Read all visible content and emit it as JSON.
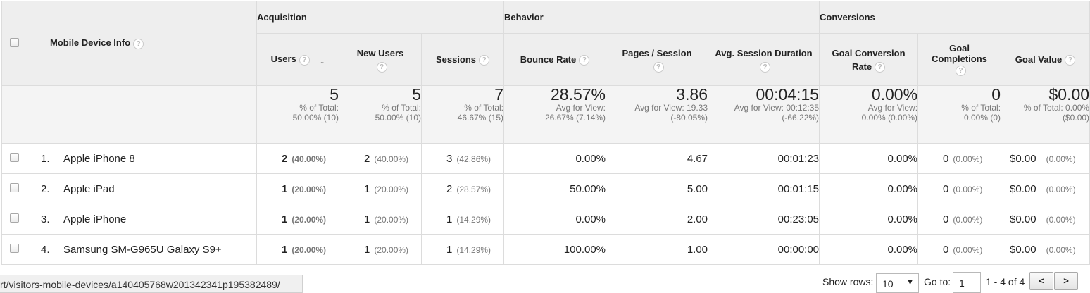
{
  "header": {
    "groups": {
      "acquisition": "Acquisition",
      "behavior": "Behavior",
      "conversions": "Conversions"
    },
    "device_col": "Mobile Device Info",
    "columns": {
      "users": "Users",
      "new_users": "New Users",
      "sessions": "Sessions",
      "bounce_rate": "Bounce Rate",
      "pages_session": "Pages / Session",
      "avg_duration": "Avg. Session Duration",
      "goal_conv_rate_1": "Goal Conversion",
      "goal_conv_rate_2": "Rate",
      "goal_completions_1": "Goal",
      "goal_completions_2": "Completions",
      "goal_value": "Goal Value"
    },
    "help_glyph": "?",
    "sort_glyph": "↓"
  },
  "totals": {
    "users": {
      "big": "5",
      "s1": "% of Total:",
      "s2": "50.00% (10)"
    },
    "new_users": {
      "big": "5",
      "s1": "% of Total:",
      "s2": "50.00% (10)"
    },
    "sessions": {
      "big": "7",
      "s1": "% of Total:",
      "s2": "46.67% (15)"
    },
    "bounce_rate": {
      "big": "28.57%",
      "s1": "Avg for View:",
      "s2": "26.67% (7.14%)"
    },
    "pages_session": {
      "big": "3.86",
      "s1": "Avg for View: 19.33",
      "s2": "(-80.05%)"
    },
    "avg_duration": {
      "big": "00:04:15",
      "s1": "Avg for View: 00:12:35",
      "s2": "(-66.22%)"
    },
    "goal_conv_rate": {
      "big": "0.00%",
      "s1": "Avg for View:",
      "s2": "0.00% (0.00%)"
    },
    "goal_completions": {
      "big": "0",
      "s1": "% of Total:",
      "s2": "0.00% (0)"
    },
    "goal_value": {
      "big": "$0.00",
      "s1": "% of Total: 0.00%",
      "s2": "($0.00)"
    }
  },
  "rows": [
    {
      "num": "1.",
      "device": "Apple iPhone 8",
      "users": "2",
      "users_pct": "(40.00%)",
      "new_users": "2",
      "new_users_pct": "(40.00%)",
      "sessions": "3",
      "sessions_pct": "(42.86%)",
      "bounce_rate": "0.00%",
      "pages_session": "4.67",
      "avg_duration": "00:01:23",
      "goal_conv_rate": "0.00%",
      "goal_completions": "0",
      "goal_completions_pct": "(0.00%)",
      "goal_value": "$0.00",
      "goal_value_pct": "(0.00%)"
    },
    {
      "num": "2.",
      "device": "Apple iPad",
      "users": "1",
      "users_pct": "(20.00%)",
      "new_users": "1",
      "new_users_pct": "(20.00%)",
      "sessions": "2",
      "sessions_pct": "(28.57%)",
      "bounce_rate": "50.00%",
      "pages_session": "5.00",
      "avg_duration": "00:01:15",
      "goal_conv_rate": "0.00%",
      "goal_completions": "0",
      "goal_completions_pct": "(0.00%)",
      "goal_value": "$0.00",
      "goal_value_pct": "(0.00%)"
    },
    {
      "num": "3.",
      "device": "Apple iPhone",
      "users": "1",
      "users_pct": "(20.00%)",
      "new_users": "1",
      "new_users_pct": "(20.00%)",
      "sessions": "1",
      "sessions_pct": "(14.29%)",
      "bounce_rate": "0.00%",
      "pages_session": "2.00",
      "avg_duration": "00:23:05",
      "goal_conv_rate": "0.00%",
      "goal_completions": "0",
      "goal_completions_pct": "(0.00%)",
      "goal_value": "$0.00",
      "goal_value_pct": "(0.00%)"
    },
    {
      "num": "4.",
      "device": "Samsung SM-G965U Galaxy S9+",
      "users": "1",
      "users_pct": "(20.00%)",
      "new_users": "1",
      "new_users_pct": "(20.00%)",
      "sessions": "1",
      "sessions_pct": "(14.29%)",
      "bounce_rate": "100.00%",
      "pages_session": "1.00",
      "avg_duration": "00:00:00",
      "goal_conv_rate": "0.00%",
      "goal_completions": "0",
      "goal_completions_pct": "(0.00%)",
      "goal_value": "$0.00",
      "goal_value_pct": "(0.00%)"
    }
  ],
  "status_url": "rt/visitors-mobile-devices/a140405768w201342341p195382489/",
  "pager": {
    "show_rows_label": "Show rows:",
    "show_rows_value": "10",
    "goto_label": "Go to:",
    "goto_value": "1",
    "range": "1 - 4 of 4",
    "prev": "<",
    "next": ">"
  }
}
